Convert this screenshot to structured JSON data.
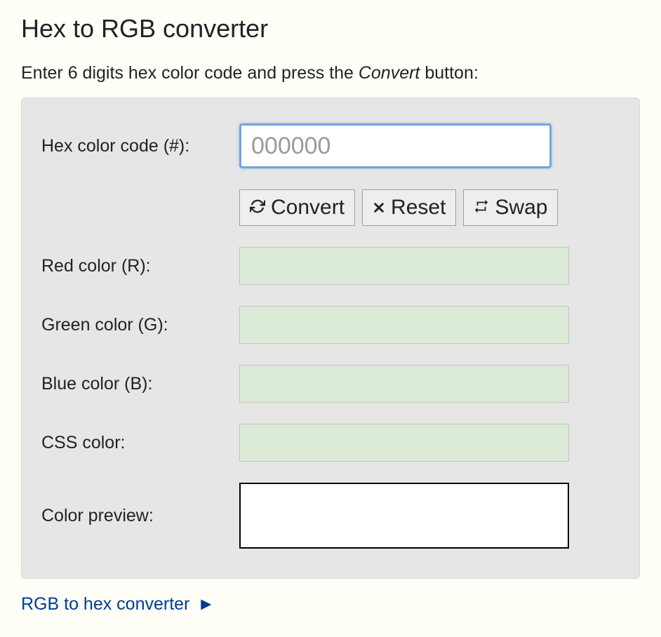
{
  "title": "Hex to RGB converter",
  "instruction_prefix": "Enter 6 digits hex color code and press the ",
  "instruction_emph": "Convert",
  "instruction_suffix": " button:",
  "form": {
    "hex_label": "Hex color code (#):",
    "hex_placeholder": "000000",
    "hex_value": "",
    "buttons": {
      "convert": "Convert",
      "reset": "Reset",
      "swap": "Swap"
    },
    "outputs": {
      "red_label": "Red color (R):",
      "red_value": "",
      "green_label": "Green color (G):",
      "green_value": "",
      "blue_label": "Blue color (B):",
      "blue_value": "",
      "css_label": "CSS color:",
      "css_value": "",
      "preview_label": "Color preview:"
    }
  },
  "link": {
    "text": "RGB to hex converter",
    "arrow": "►"
  }
}
